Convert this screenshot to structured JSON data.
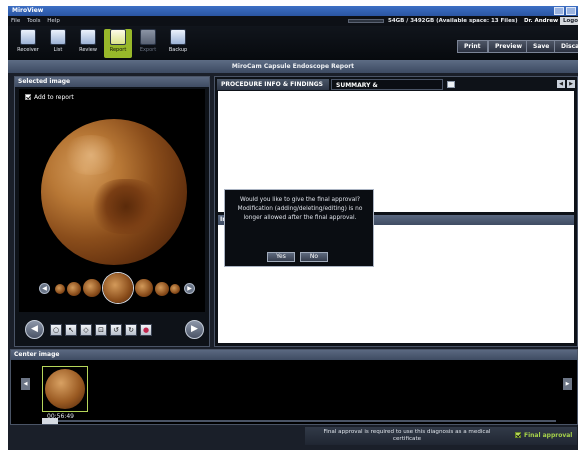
{
  "window": {
    "title": "MiroView"
  },
  "menu": {
    "items": [
      "File",
      "Tools",
      "Help"
    ]
  },
  "storage": {
    "text": "54GB / 3492GB (Available space: 13 Files)",
    "user": "Dr. Andrew",
    "logout": "Logo"
  },
  "toolbar": {
    "items": [
      {
        "label": "Receiver",
        "icon": "receiver-icon",
        "state": "normal"
      },
      {
        "label": "List",
        "icon": "list-icon",
        "state": "normal"
      },
      {
        "label": "Review",
        "icon": "review-icon",
        "state": "normal"
      },
      {
        "label": "Report",
        "icon": "report-icon",
        "state": "active"
      },
      {
        "label": "Export",
        "icon": "export-icon",
        "state": "disabled"
      },
      {
        "label": "Backup",
        "icon": "backup-icon",
        "state": "normal"
      }
    ]
  },
  "actions": {
    "print": "Print",
    "preview": "Preview",
    "save": "Save",
    "discard": "Discar"
  },
  "report": {
    "title": "MiroCam Capsule Endoscope Report"
  },
  "selected_image": {
    "title": "Selected image",
    "add_to_report": "Add to report",
    "add_checked": true
  },
  "tabs": {
    "procedure": "PROCEDURE INFO & FINDINGS",
    "summary": "SUMMARY & RECOMMENDATIONS"
  },
  "midlabel": "Im",
  "dialog": {
    "message": "Would you like to give the final approval? Modification (adding/deleting/editing) is no longer allowed after the final approval.",
    "yes": "Yes",
    "no": "No"
  },
  "center_image": {
    "title": "Center image",
    "timestamp": "00:56:49"
  },
  "status": {
    "note": "Final approval is required to use this diagnosis as a medical certificate",
    "approval": "Final approval",
    "approval_checked": true
  },
  "colors": {
    "accent": "#98b82a",
    "titlebar": "#2a55a2",
    "panel_header": "#4a5668"
  }
}
